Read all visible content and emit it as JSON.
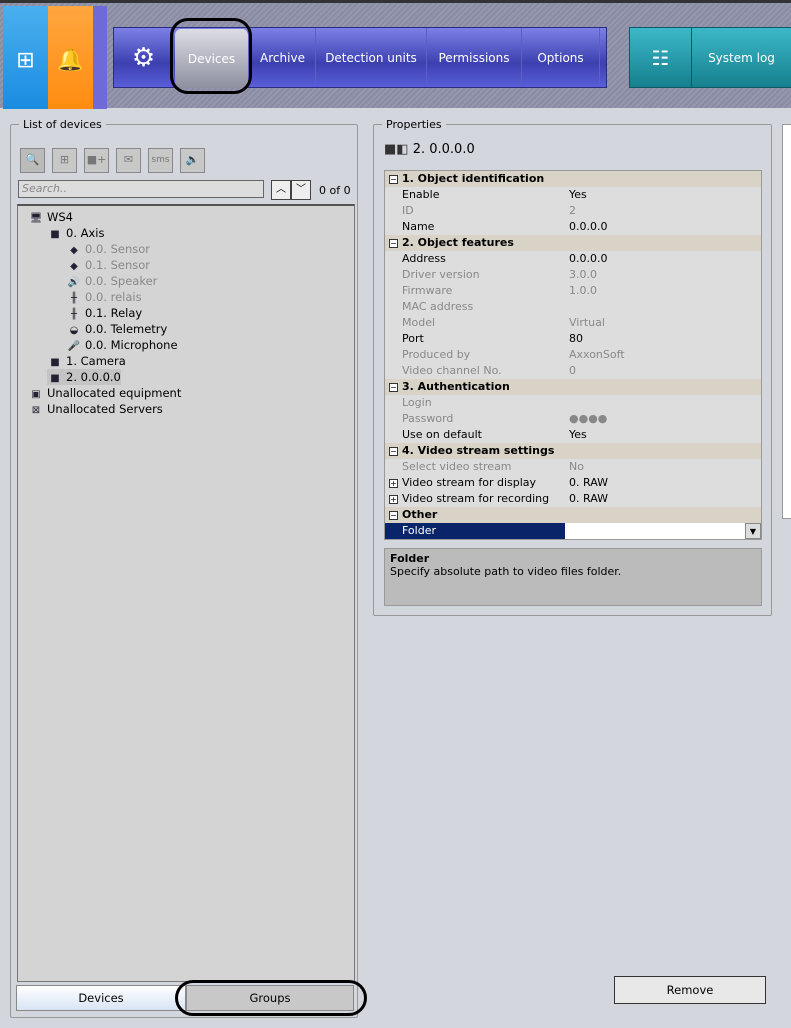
{
  "nav": {
    "main_items": [
      "Devices",
      "Archive",
      "Detection units",
      "Permissions",
      "Options"
    ],
    "system_log": "System log"
  },
  "devices_panel": {
    "title": "List of devices",
    "search_placeholder": "Search..",
    "count": "0 of 0",
    "toolbar": [
      "find-camera",
      "add-computer",
      "add-camera",
      "add-email",
      "add-sms",
      "add-audio"
    ],
    "tree": [
      {
        "label": "WS4",
        "level": 0,
        "grey": false,
        "icon": "🖥"
      },
      {
        "label": "0. Axis",
        "level": 1,
        "grey": false,
        "icon": "■"
      },
      {
        "label": "0.0. Sensor",
        "level": 2,
        "grey": true,
        "icon": "◆"
      },
      {
        "label": "0.1. Sensor",
        "level": 2,
        "grey": true,
        "icon": "◆"
      },
      {
        "label": "0.0. Speaker",
        "level": 2,
        "grey": true,
        "icon": "🔊"
      },
      {
        "label": "0.0. relais",
        "level": 2,
        "grey": true,
        "icon": "╫"
      },
      {
        "label": "0.1. Relay",
        "level": 2,
        "grey": false,
        "icon": "╫"
      },
      {
        "label": "0.0. Telemetry",
        "level": 2,
        "grey": false,
        "icon": "◒"
      },
      {
        "label": "0.0. Microphone",
        "level": 2,
        "grey": false,
        "icon": "🎤"
      },
      {
        "label": "1. Camera",
        "level": 1,
        "grey": false,
        "icon": "■"
      },
      {
        "label": "2. 0.0.0.0",
        "level": 1,
        "grey": false,
        "icon": "■"
      },
      {
        "label": "Unallocated equipment",
        "level": 0,
        "grey": false,
        "icon": "▣"
      },
      {
        "label": "Unallocated Servers",
        "level": 0,
        "grey": false,
        "icon": "⊠"
      }
    ],
    "tabs": [
      "Devices",
      "Groups"
    ]
  },
  "properties": {
    "title": "Properties",
    "device": "2. 0.0.0.0",
    "rows": [
      {
        "cat": "1. Object identification"
      },
      {
        "l": "Enable",
        "v": "Yes"
      },
      {
        "l": "ID",
        "v": "2",
        "g": true
      },
      {
        "l": "Name",
        "v": "0.0.0.0"
      },
      {
        "cat": "2. Object features"
      },
      {
        "l": "Address",
        "v": "0.0.0.0"
      },
      {
        "l": "Driver version",
        "v": "3.0.0",
        "g": true
      },
      {
        "l": "Firmware",
        "v": "1.0.0",
        "g": true
      },
      {
        "l": "MAC address",
        "v": "",
        "g": true
      },
      {
        "l": "Model",
        "v": "Virtual",
        "g": true
      },
      {
        "l": "Port",
        "v": "80"
      },
      {
        "l": "Produced by",
        "v": "AxxonSoft",
        "g": true
      },
      {
        "l": "Video channel No.",
        "v": "0",
        "g": true
      },
      {
        "cat": "3. Authentication"
      },
      {
        "l": "Login",
        "v": "",
        "g": true
      },
      {
        "l": "Password",
        "v": "●●●●",
        "g": true
      },
      {
        "l": "Use on default",
        "v": "Yes"
      },
      {
        "cat": "4. Video stream settings"
      },
      {
        "l": "Select video stream",
        "v": "No",
        "g": true
      },
      {
        "l": "Video stream for display",
        "v": "0. RAW",
        "x": true
      },
      {
        "l": "Video stream for recording",
        "v": "0. RAW",
        "x": true
      },
      {
        "cat": "Other"
      },
      {
        "l": "Folder",
        "v": "",
        "sel": true
      }
    ],
    "desc_title": "Folder",
    "desc_text": "Specify absolute path to video files folder.",
    "remove": "Remove"
  }
}
